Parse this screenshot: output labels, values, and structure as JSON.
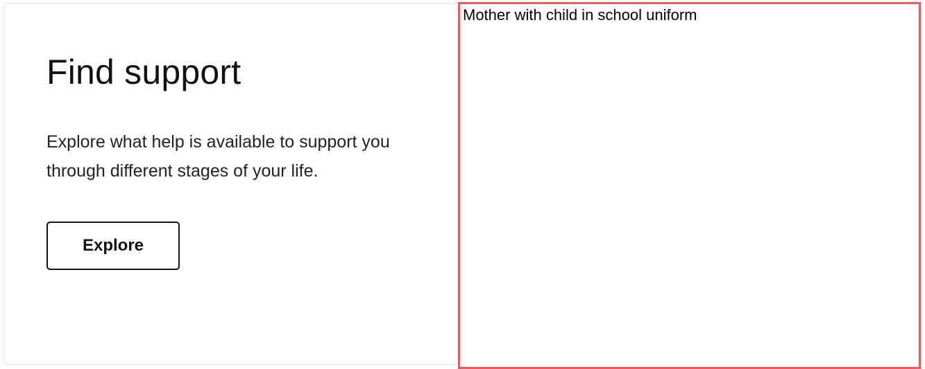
{
  "card": {
    "title": "Find support",
    "description": "Explore what help is available to support you through different stages of your life.",
    "button_label": "Explore",
    "image_alt": "Mother with child in school uniform"
  },
  "colors": {
    "text": "#111111",
    "card_border": "#e3e3e3",
    "image_frame_border": "#ef5a5a"
  }
}
